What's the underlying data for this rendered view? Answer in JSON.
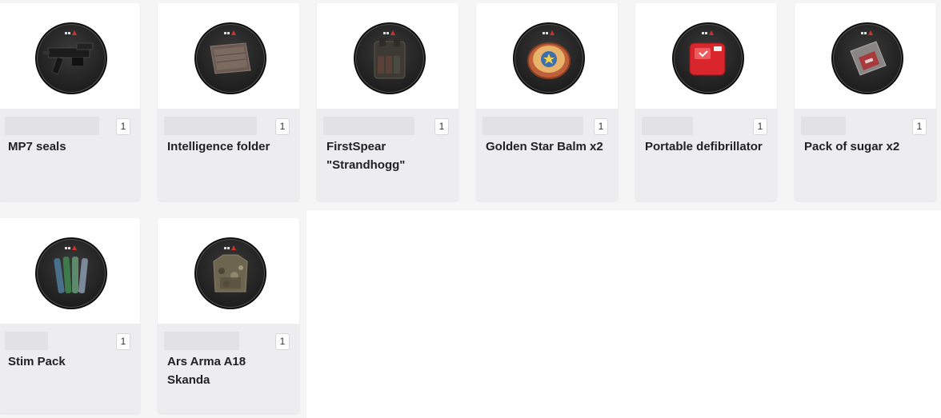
{
  "items": [
    {
      "name": "MP7 seals",
      "qty": "1",
      "icon": "mp7-seals-icon"
    },
    {
      "name": "Intelligence folder",
      "qty": "1",
      "icon": "intelligence-folder-icon"
    },
    {
      "name": "FirstSpear\n\"Strandhogg\"",
      "qty": "1",
      "icon": "plate-carrier-icon"
    },
    {
      "name": "Golden Star Balm x2",
      "qty": "1",
      "icon": "golden-star-balm-icon"
    },
    {
      "name": "Portable defibrillator",
      "qty": "1",
      "icon": "defibrillator-icon"
    },
    {
      "name": "Pack of sugar x2",
      "qty": "1",
      "icon": "sugar-pack-icon"
    },
    {
      "name": "Stim Pack",
      "qty": "1",
      "icon": "stim-pack-icon"
    },
    {
      "name": "Ars Arma A18\nSkanda",
      "qty": "1",
      "icon": "armor-vest-icon"
    }
  ],
  "colors": {
    "card": "#ededef",
    "card_top": "#ffffff",
    "page": "#f5f5f6",
    "text": "#222222"
  }
}
